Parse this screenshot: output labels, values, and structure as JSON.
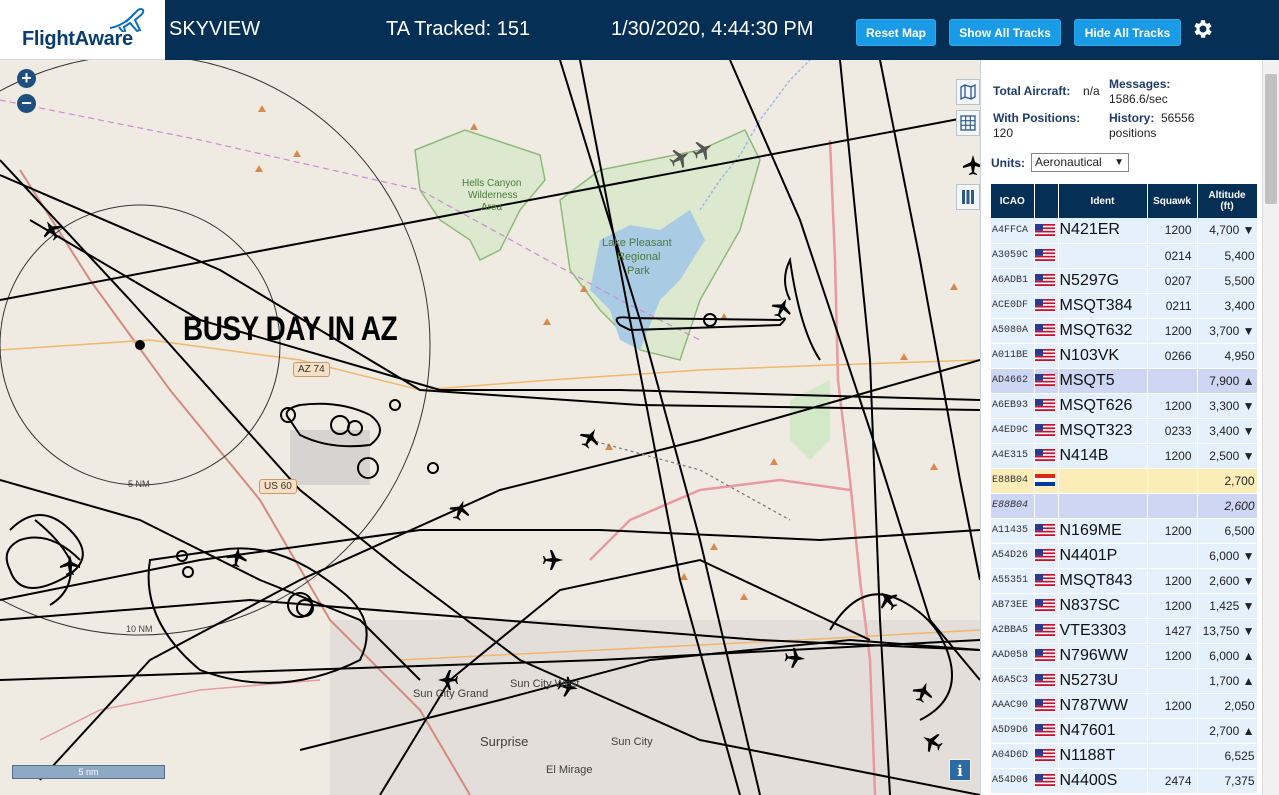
{
  "header": {
    "logo_text": "FlightAware",
    "app_title": "SKYVIEW",
    "ta_tracked": "TA Tracked: 151",
    "datetime": "1/30/2020, 4:44:30 PM",
    "reset_map": "Reset Map",
    "show_all": "Show All Tracks",
    "hide_all": "Hide All Tracks",
    "settings_icon": "gear-icon"
  },
  "map": {
    "overlay_text": "BUSY DAY IN AZ",
    "zoom_in": "+",
    "zoom_out": "−",
    "tools": [
      "map-icon",
      "grid-icon",
      "plane-icon",
      "columns-icon"
    ],
    "ring_labels": [
      "5 NM",
      "10 NM"
    ],
    "scale_text": "5 nm",
    "info_button": "i",
    "places": {
      "hells_canyon": "Hells Canyon",
      "wilderness": "Wilderness",
      "area": "Area",
      "lake_pleasant": "Lake Pleasant",
      "regional": "Regional",
      "park": "Park",
      "sun_city_grand": "Sun City Grand",
      "sun_city_west": "Sun City West",
      "sun_city": "Sun City",
      "surprise": "Surprise",
      "el_mirage": "El Mirage"
    },
    "road_badges": [
      "AZ 74",
      "US 60"
    ],
    "colors": {
      "background": "#efebe3",
      "track": "#000000",
      "water": "#a9cbe3",
      "park": "#d3e8c6",
      "highway": "#e89aa0"
    }
  },
  "stats": {
    "total_aircraft_label": "Total Aircraft:",
    "total_aircraft_value": "n/a",
    "with_positions_label": "With Positions:",
    "with_positions_value": "120",
    "messages_label": "Messages:",
    "messages_value": "1586.6/sec",
    "history_label": "History:",
    "history_value": "56556",
    "history_unit": "positions",
    "units_label": "Units:",
    "units_value": "Aeronautical"
  },
  "table": {
    "headers": {
      "icao": "ICAO",
      "ident": "Ident",
      "squawk": "Squawk",
      "altitude": "Altitude",
      "altitude_unit": "(ft)"
    },
    "rows": [
      {
        "icao": "A4FFCA",
        "flag": "us",
        "ident": "N421ER",
        "squawk": "1200",
        "alt": "4,700 ▼",
        "state": ""
      },
      {
        "icao": "A3059C",
        "flag": "us",
        "ident": "",
        "squawk": "0214",
        "alt": "5,400",
        "state": ""
      },
      {
        "icao": "A6ADB1",
        "flag": "us",
        "ident": "N5297G",
        "squawk": "0207",
        "alt": "5,500",
        "state": ""
      },
      {
        "icao": "ACE0DF",
        "flag": "us",
        "ident": "MSQT384",
        "squawk": "0211",
        "alt": "3,400",
        "state": ""
      },
      {
        "icao": "A5080A",
        "flag": "us",
        "ident": "MSQT632",
        "squawk": "1200",
        "alt": "3,700 ▼",
        "state": ""
      },
      {
        "icao": "A011BE",
        "flag": "us",
        "ident": "N103VK",
        "squawk": "0266",
        "alt": "4,950",
        "state": ""
      },
      {
        "icao": "AD4662",
        "flag": "us",
        "ident": "MSQT5",
        "squawk": "",
        "alt": "7,900 ▲",
        "state": "sel"
      },
      {
        "icao": "A6EB93",
        "flag": "us",
        "ident": "MSQT626",
        "squawk": "1200",
        "alt": "3,300 ▼",
        "state": ""
      },
      {
        "icao": "A4ED9C",
        "flag": "us",
        "ident": "MSQT323",
        "squawk": "0233",
        "alt": "3,400 ▼",
        "state": ""
      },
      {
        "icao": "A4E315",
        "flag": "us",
        "ident": "N414B",
        "squawk": "1200",
        "alt": "2,500 ▼",
        "state": ""
      },
      {
        "icao": "E88B04",
        "flag": "py",
        "ident": "",
        "squawk": "",
        "alt": "2,700",
        "state": "hl"
      },
      {
        "icao": "E88B04",
        "flag": "",
        "ident": "",
        "squawk": "",
        "alt": "2,600",
        "state": "dim"
      },
      {
        "icao": "A11435",
        "flag": "us",
        "ident": "N169ME",
        "squawk": "1200",
        "alt": "6,500",
        "state": ""
      },
      {
        "icao": "A54D26",
        "flag": "us",
        "ident": "N4401P",
        "squawk": "",
        "alt": "6,000 ▼",
        "state": ""
      },
      {
        "icao": "A55351",
        "flag": "us",
        "ident": "MSQT843",
        "squawk": "1200",
        "alt": "2,600 ▼",
        "state": ""
      },
      {
        "icao": "AB73EE",
        "flag": "us",
        "ident": "N837SC",
        "squawk": "1200",
        "alt": "1,425 ▼",
        "state": ""
      },
      {
        "icao": "A2BBA5",
        "flag": "us",
        "ident": "VTE3303",
        "squawk": "1427",
        "alt": "13,750 ▼",
        "state": ""
      },
      {
        "icao": "AAD058",
        "flag": "us",
        "ident": "N796WW",
        "squawk": "1200",
        "alt": "6,000 ▲",
        "state": ""
      },
      {
        "icao": "A6A5C3",
        "flag": "us",
        "ident": "N5273U",
        "squawk": "",
        "alt": "1,700 ▲",
        "state": ""
      },
      {
        "icao": "AAAC90",
        "flag": "us",
        "ident": "N787WW",
        "squawk": "1200",
        "alt": "2,050",
        "state": ""
      },
      {
        "icao": "A5D9D6",
        "flag": "us",
        "ident": "N47601",
        "squawk": "",
        "alt": "2,700 ▲",
        "state": ""
      },
      {
        "icao": "A04D6D",
        "flag": "us",
        "ident": "N1188T",
        "squawk": "",
        "alt": "6,525",
        "state": ""
      },
      {
        "icao": "A54D06",
        "flag": "us",
        "ident": "N4400S",
        "squawk": "2474",
        "alt": "7,375",
        "state": ""
      }
    ]
  }
}
